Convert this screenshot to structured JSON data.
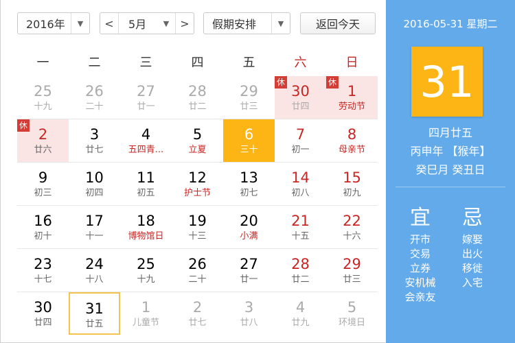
{
  "toolbar": {
    "year_value": "2016年",
    "month_value": "5月",
    "prev_symbol": "<",
    "next_symbol": ">",
    "holiday_select": "假期安排",
    "dropdown_symbol": "▼",
    "today_button": "返回今天"
  },
  "weekdays": [
    "一",
    "二",
    "三",
    "四",
    "五",
    "六",
    "日"
  ],
  "rest_label": "休",
  "weeks": [
    [
      {
        "num": "25",
        "lunar": "十九",
        "other": true
      },
      {
        "num": "26",
        "lunar": "二十",
        "other": true
      },
      {
        "num": "27",
        "lunar": "廿一",
        "other": true
      },
      {
        "num": "28",
        "lunar": "廿二",
        "other": true
      },
      {
        "num": "29",
        "lunar": "廿三",
        "other": true
      },
      {
        "num": "30",
        "lunar": "廿四",
        "other": true,
        "holiday": true,
        "rest": true
      },
      {
        "num": "1",
        "lunar": "劳动节",
        "festival": true,
        "holiday": true,
        "rest": true
      }
    ],
    [
      {
        "num": "2",
        "lunar": "廿六",
        "holiday": true,
        "rest": true
      },
      {
        "num": "3",
        "lunar": "廿七"
      },
      {
        "num": "4",
        "lunar": "五四青...",
        "festival": true
      },
      {
        "num": "5",
        "lunar": "立夏",
        "festival": true
      },
      {
        "num": "6",
        "lunar": "三十",
        "selected": true
      },
      {
        "num": "7",
        "lunar": "初一"
      },
      {
        "num": "8",
        "lunar": "母亲节",
        "festival": true
      }
    ],
    [
      {
        "num": "9",
        "lunar": "初三"
      },
      {
        "num": "10",
        "lunar": "初四"
      },
      {
        "num": "11",
        "lunar": "初五"
      },
      {
        "num": "12",
        "lunar": "护士节",
        "festival": true
      },
      {
        "num": "13",
        "lunar": "初七"
      },
      {
        "num": "14",
        "lunar": "初八"
      },
      {
        "num": "15",
        "lunar": "初九"
      }
    ],
    [
      {
        "num": "16",
        "lunar": "初十"
      },
      {
        "num": "17",
        "lunar": "十一"
      },
      {
        "num": "18",
        "lunar": "博物馆日",
        "festival": true
      },
      {
        "num": "19",
        "lunar": "十三"
      },
      {
        "num": "20",
        "lunar": "小满",
        "festival": true
      },
      {
        "num": "21",
        "lunar": "十五"
      },
      {
        "num": "22",
        "lunar": "十六"
      }
    ],
    [
      {
        "num": "23",
        "lunar": "十七"
      },
      {
        "num": "24",
        "lunar": "十八"
      },
      {
        "num": "25",
        "lunar": "十九"
      },
      {
        "num": "26",
        "lunar": "二十"
      },
      {
        "num": "27",
        "lunar": "廿一"
      },
      {
        "num": "28",
        "lunar": "廿二"
      },
      {
        "num": "29",
        "lunar": "廿三"
      }
    ],
    [
      {
        "num": "30",
        "lunar": "廿四"
      },
      {
        "num": "31",
        "lunar": "廿五",
        "today": true
      },
      {
        "num": "1",
        "lunar": "儿童节",
        "other": true
      },
      {
        "num": "2",
        "lunar": "廿七",
        "other": true
      },
      {
        "num": "3",
        "lunar": "廿八",
        "other": true
      },
      {
        "num": "4",
        "lunar": "廿九",
        "other": true
      },
      {
        "num": "5",
        "lunar": "环境日",
        "other": true
      }
    ]
  ],
  "sidebar": {
    "date_line": "2016-05-31 星期二",
    "big_day": "31",
    "lunar_date": "四月廿五",
    "ganzhi_year": "丙申年 【猴年】",
    "ganzhi_month_day": "癸巳月 癸丑日",
    "yi_title": "宜",
    "ji_title": "忌",
    "yi_items": [
      "开市",
      "交易",
      "立券",
      "安机械",
      "会亲友"
    ],
    "ji_items": [
      "嫁娶",
      "出火",
      "移徙",
      "入宅"
    ]
  },
  "colors": {
    "accent_orange": "#fcb514",
    "sidebar_blue": "#63aaeb",
    "holiday_red": "#c82623",
    "holiday_bg": "#fbe5e4",
    "rest_badge": "#d43d36"
  }
}
